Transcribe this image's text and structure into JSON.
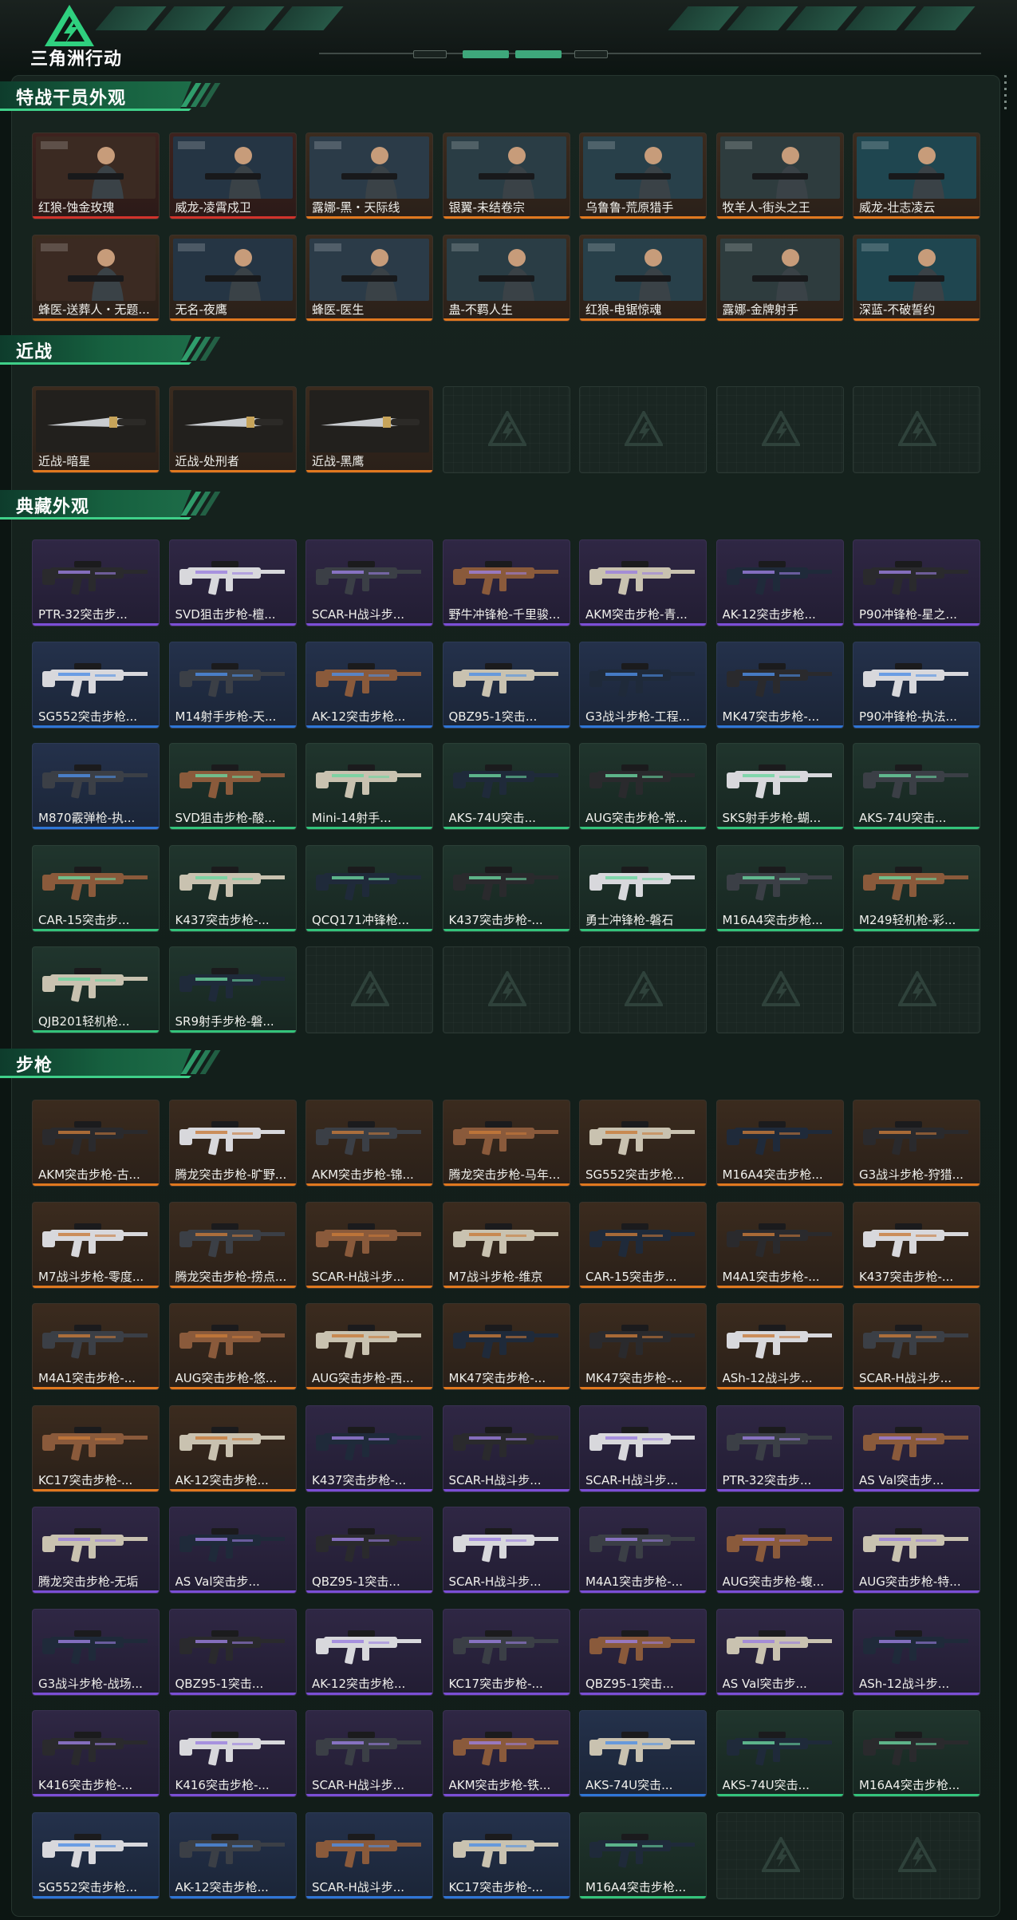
{
  "app": {
    "title": "三角洲行动"
  },
  "colors": {
    "accent": "#3fd089",
    "orange": "#e0781f",
    "red": "#d1332c",
    "purple": "#7b4fd6",
    "blue": "#2f76d6",
    "green": "#34c37b"
  },
  "sections": [
    {
      "title": "特战干员外观",
      "empty": 0,
      "items": [
        {
          "name": "红狼-蚀金玫瑰",
          "rarity": "red",
          "kind": "op"
        },
        {
          "name": "威龙-凌霄戍卫",
          "rarity": "red",
          "kind": "op"
        },
        {
          "name": "露娜-黑・天际线",
          "rarity": "orange",
          "kind": "op"
        },
        {
          "name": "银翼-未结卷宗",
          "rarity": "orange",
          "kind": "op"
        },
        {
          "name": "乌鲁鲁-荒原猎手",
          "rarity": "orange",
          "kind": "op"
        },
        {
          "name": "牧羊人-街头之王",
          "rarity": "orange",
          "kind": "op"
        },
        {
          "name": "威龙-壮志凌云",
          "rarity": "orange",
          "kind": "op"
        },
        {
          "name": "蜂医-送葬人・无题...",
          "rarity": "orange",
          "kind": "op"
        },
        {
          "name": "无名-夜鹰",
          "rarity": "orange",
          "kind": "op"
        },
        {
          "name": "蜂医-医生",
          "rarity": "orange",
          "kind": "op"
        },
        {
          "name": "蛊-不羁人生",
          "rarity": "orange",
          "kind": "op"
        },
        {
          "name": "红狼-电锯惊魂",
          "rarity": "orange",
          "kind": "op"
        },
        {
          "name": "露娜-金牌射手",
          "rarity": "orange",
          "kind": "op"
        },
        {
          "name": "深蓝-不破誓约",
          "rarity": "orange",
          "kind": "op"
        }
      ]
    },
    {
      "title": "近战",
      "empty": 4,
      "items": [
        {
          "name": "近战-暗星",
          "rarity": "orange",
          "kind": "knife"
        },
        {
          "name": "近战-处刑者",
          "rarity": "orange",
          "kind": "knife"
        },
        {
          "name": "近战-黑鹰",
          "rarity": "orange",
          "kind": "knife"
        }
      ]
    },
    {
      "title": "典藏外观",
      "empty": 5,
      "items": [
        {
          "name": "PTR-32突击步...",
          "rarity": "purple",
          "kind": "gun"
        },
        {
          "name": "SVD狙击步枪-檀...",
          "rarity": "purple",
          "kind": "gun"
        },
        {
          "name": "SCAR-H战斗步...",
          "rarity": "purple",
          "kind": "gun"
        },
        {
          "name": "野牛冲锋枪-千里骏...",
          "rarity": "purple",
          "kind": "gun"
        },
        {
          "name": "AKM突击步枪-青...",
          "rarity": "purple",
          "kind": "gun"
        },
        {
          "name": "AK-12突击步枪...",
          "rarity": "purple",
          "kind": "gun"
        },
        {
          "name": "P90冲锋枪-星之...",
          "rarity": "purple",
          "kind": "gun"
        },
        {
          "name": "SG552突击步枪...",
          "rarity": "blue",
          "kind": "gun"
        },
        {
          "name": "M14射手步枪-天...",
          "rarity": "blue",
          "kind": "gun"
        },
        {
          "name": "AK-12突击步枪...",
          "rarity": "blue",
          "kind": "gun"
        },
        {
          "name": "QBZ95-1突击...",
          "rarity": "blue",
          "kind": "gun"
        },
        {
          "name": "G3战斗步枪-工程...",
          "rarity": "blue",
          "kind": "gun"
        },
        {
          "name": "MK47突击步枪-...",
          "rarity": "blue",
          "kind": "gun"
        },
        {
          "name": "P90冲锋枪-执法...",
          "rarity": "blue",
          "kind": "gun"
        },
        {
          "name": "M870霰弹枪-执...",
          "rarity": "blue",
          "kind": "gun"
        },
        {
          "name": "SVD狙击步枪-酸...",
          "rarity": "green",
          "kind": "gun"
        },
        {
          "name": "Mini-14射手...",
          "rarity": "green",
          "kind": "gun"
        },
        {
          "name": "AKS-74U突击...",
          "rarity": "green",
          "kind": "gun"
        },
        {
          "name": "AUG突击步枪-常...",
          "rarity": "green",
          "kind": "gun"
        },
        {
          "name": "SKS射手步枪-蝴...",
          "rarity": "green",
          "kind": "gun"
        },
        {
          "name": "AKS-74U突击...",
          "rarity": "green",
          "kind": "gun"
        },
        {
          "name": "CAR-15突击步...",
          "rarity": "green",
          "kind": "gun"
        },
        {
          "name": "K437突击步枪-...",
          "rarity": "green",
          "kind": "gun"
        },
        {
          "name": "QCQ171冲锋枪...",
          "rarity": "green",
          "kind": "gun"
        },
        {
          "name": "K437突击步枪-...",
          "rarity": "green",
          "kind": "gun"
        },
        {
          "name": "勇士冲锋枪-磐石",
          "rarity": "green",
          "kind": "gun"
        },
        {
          "name": "M16A4突击步枪...",
          "rarity": "green",
          "kind": "gun"
        },
        {
          "name": "M249轻机枪-彩...",
          "rarity": "green",
          "kind": "gun"
        },
        {
          "name": "QJB201轻机枪...",
          "rarity": "green",
          "kind": "gun"
        },
        {
          "name": "SR9射手步枪-磐...",
          "rarity": "green",
          "kind": "gun"
        }
      ]
    },
    {
      "title": "步枪",
      "empty": 2,
      "items": [
        {
          "name": "AKM突击步枪-古...",
          "rarity": "orange",
          "kind": "gun"
        },
        {
          "name": "腾龙突击步枪-旷野...",
          "rarity": "orange",
          "kind": "gun"
        },
        {
          "name": "AKM突击步枪-锦...",
          "rarity": "orange",
          "kind": "gun"
        },
        {
          "name": "腾龙突击步枪-马年...",
          "rarity": "orange",
          "kind": "gun"
        },
        {
          "name": "SG552突击步枪...",
          "rarity": "orange",
          "kind": "gun"
        },
        {
          "name": "M16A4突击步枪...",
          "rarity": "orange",
          "kind": "gun"
        },
        {
          "name": "G3战斗步枪-狩猎...",
          "rarity": "orange",
          "kind": "gun"
        },
        {
          "name": "M7战斗步枪-零度...",
          "rarity": "orange",
          "kind": "gun"
        },
        {
          "name": "腾龙突击步枪-捞点...",
          "rarity": "orange",
          "kind": "gun"
        },
        {
          "name": "SCAR-H战斗步...",
          "rarity": "orange",
          "kind": "gun"
        },
        {
          "name": "M7战斗步枪-维京",
          "rarity": "orange",
          "kind": "gun"
        },
        {
          "name": "CAR-15突击步...",
          "rarity": "orange",
          "kind": "gun"
        },
        {
          "name": "M4A1突击步枪-...",
          "rarity": "orange",
          "kind": "gun"
        },
        {
          "name": "K437突击步枪-...",
          "rarity": "orange",
          "kind": "gun"
        },
        {
          "name": "M4A1突击步枪-...",
          "rarity": "orange",
          "kind": "gun"
        },
        {
          "name": "AUG突击步枪-悠...",
          "rarity": "orange",
          "kind": "gun"
        },
        {
          "name": "AUG突击步枪-西...",
          "rarity": "orange",
          "kind": "gun"
        },
        {
          "name": "MK47突击步枪-...",
          "rarity": "orange",
          "kind": "gun"
        },
        {
          "name": "MK47突击步枪-...",
          "rarity": "orange",
          "kind": "gun"
        },
        {
          "name": "ASh-12战斗步...",
          "rarity": "orange",
          "kind": "gun"
        },
        {
          "name": "SCAR-H战斗步...",
          "rarity": "orange",
          "kind": "gun"
        },
        {
          "name": "KC17突击步枪-...",
          "rarity": "orange",
          "kind": "gun"
        },
        {
          "name": "AK-12突击步枪...",
          "rarity": "orange",
          "kind": "gun"
        },
        {
          "name": "K437突击步枪-...",
          "rarity": "purple",
          "kind": "gun"
        },
        {
          "name": "SCAR-H战斗步...",
          "rarity": "purple",
          "kind": "gun"
        },
        {
          "name": "SCAR-H战斗步...",
          "rarity": "purple",
          "kind": "gun"
        },
        {
          "name": "PTR-32突击步...",
          "rarity": "purple",
          "kind": "gun"
        },
        {
          "name": "AS Val突击步...",
          "rarity": "purple",
          "kind": "gun"
        },
        {
          "name": "腾龙突击步枪-无垢",
          "rarity": "purple",
          "kind": "gun"
        },
        {
          "name": "AS Val突击步...",
          "rarity": "purple",
          "kind": "gun"
        },
        {
          "name": "QBZ95-1突击...",
          "rarity": "purple",
          "kind": "gun"
        },
        {
          "name": "SCAR-H战斗步...",
          "rarity": "purple",
          "kind": "gun"
        },
        {
          "name": "M4A1突击步枪-...",
          "rarity": "purple",
          "kind": "gun"
        },
        {
          "name": "AUG突击步枪-蝮...",
          "rarity": "purple",
          "kind": "gun"
        },
        {
          "name": "AUG突击步枪-特...",
          "rarity": "purple",
          "kind": "gun"
        },
        {
          "name": "G3战斗步枪-战场...",
          "rarity": "purple",
          "kind": "gun"
        },
        {
          "name": "QBZ95-1突击...",
          "rarity": "purple",
          "kind": "gun"
        },
        {
          "name": "AK-12突击步枪...",
          "rarity": "purple",
          "kind": "gun"
        },
        {
          "name": "KC17突击步枪-...",
          "rarity": "purple",
          "kind": "gun"
        },
        {
          "name": "QBZ95-1突击...",
          "rarity": "purple",
          "kind": "gun"
        },
        {
          "name": "AS Val突击步...",
          "rarity": "purple",
          "kind": "gun"
        },
        {
          "name": "ASh-12战斗步...",
          "rarity": "purple",
          "kind": "gun"
        },
        {
          "name": "K416突击步枪-...",
          "rarity": "purple",
          "kind": "gun"
        },
        {
          "name": "K416突击步枪-...",
          "rarity": "purple",
          "kind": "gun"
        },
        {
          "name": "SCAR-H战斗步...",
          "rarity": "purple",
          "kind": "gun"
        },
        {
          "name": "AKM突击步枪-铁...",
          "rarity": "purple",
          "kind": "gun"
        },
        {
          "name": "AKS-74U突击...",
          "rarity": "blue",
          "kind": "gun"
        },
        {
          "name": "AKS-74U突击...",
          "rarity": "green",
          "kind": "gun"
        },
        {
          "name": "M16A4突击步枪...",
          "rarity": "green",
          "kind": "gun"
        },
        {
          "name": "SG552突击步枪...",
          "rarity": "blue",
          "kind": "gun"
        },
        {
          "name": "AK-12突击步枪...",
          "rarity": "blue",
          "kind": "gun"
        },
        {
          "name": "SCAR-H战斗步...",
          "rarity": "blue",
          "kind": "gun"
        },
        {
          "name": "KC17突击步枪-...",
          "rarity": "blue",
          "kind": "gun"
        },
        {
          "name": "M16A4突击步枪...",
          "rarity": "green",
          "kind": "gun"
        }
      ]
    }
  ]
}
